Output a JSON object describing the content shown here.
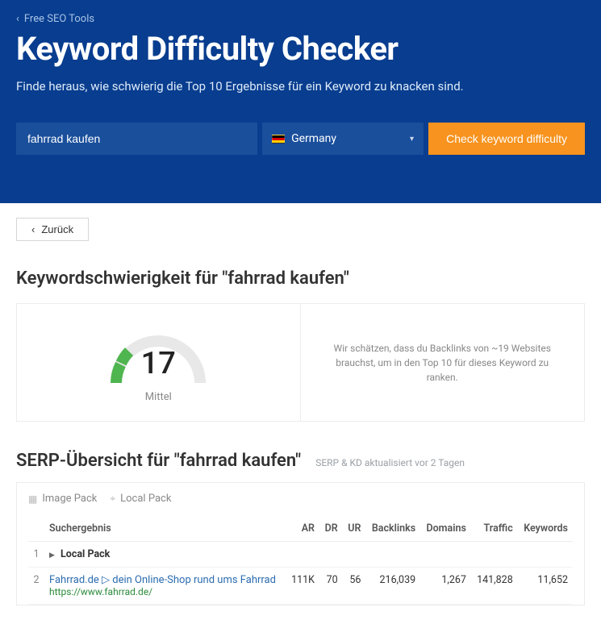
{
  "hero": {
    "breadcrumb": "Free SEO Tools",
    "title": "Keyword Difficulty Checker",
    "subtitle": "Finde heraus, wie schwierig die Top 10 Ergebnisse für ein Keyword zu knacken sind.",
    "keyword_value": "fahrrad kaufen",
    "country": "Germany",
    "button": "Check keyword difficulty"
  },
  "back": "Zurück",
  "kd_title": "Keywordschwierigkeit für \"fahrrad kaufen\"",
  "kd_score": "17",
  "kd_label": "Mittel",
  "kd_estimate": "Wir schätzen, dass du Backlinks von ~19 Websites brauchst, um in den Top 10 für dieses Keyword zu ranken.",
  "serp_title": "SERP-Übersicht für \"fahrrad kaufen\"",
  "serp_meta": "SERP & KD aktualisiert vor 2 Tagen",
  "features": {
    "image_pack": "Image Pack",
    "local_pack": "Local Pack"
  },
  "columns": {
    "result": "Suchergebnis",
    "ar": "AR",
    "dr": "DR",
    "ur": "UR",
    "backlinks": "Backlinks",
    "domains": "Domains",
    "traffic": "Traffic",
    "keywords": "Keywords"
  },
  "rows": [
    {
      "pos": "1",
      "special": "Local Pack"
    },
    {
      "pos": "2",
      "title": "Fahrrad.de ▷ dein Online-Shop rund ums Fahrrad",
      "url": "https://www.fahrrad.de/",
      "ar": "111K",
      "dr": "70",
      "ur": "56",
      "backlinks": "216,039",
      "domains": "1,267",
      "traffic": "141,828",
      "keywords": "11,652"
    }
  ]
}
